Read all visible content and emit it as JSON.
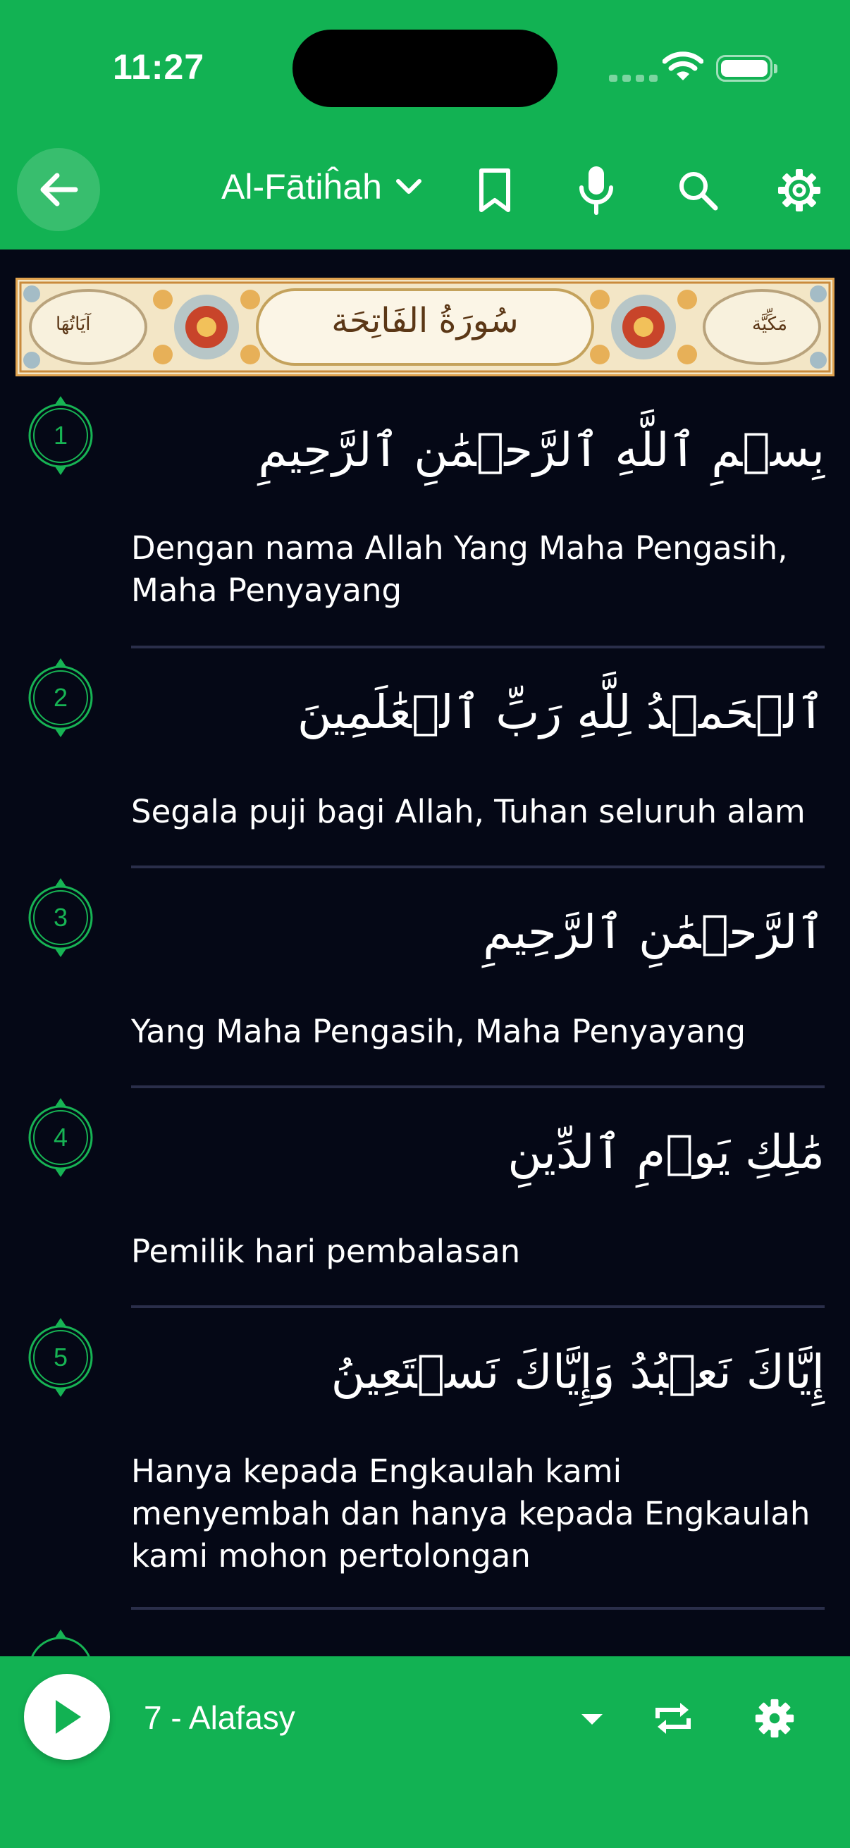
{
  "status_bar": {
    "time": "11:27"
  },
  "header": {
    "back_icon": "arrow-left-icon",
    "surah_title": "Al-Fātiĥah",
    "icons": [
      "bookmark-icon",
      "microphone-icon",
      "search-icon",
      "gear-icon"
    ]
  },
  "banner": {
    "surah_name_ar": "سُورَةُ الفَاتِحَة",
    "left_label": "آيَاتُهَا",
    "right_label": "مَكِّيَّة"
  },
  "verses": [
    {
      "number": "1",
      "arabic": "بِسۡمِ ٱللَّهِ ٱلرَّحۡمَٰنِ ٱلرَّحِيمِ",
      "translation": "Dengan nama Allah Yang Maha Pengasih, Maha Penyayang"
    },
    {
      "number": "2",
      "arabic": "ٱلۡحَمۡدُ لِلَّهِ رَبِّ ٱلۡعَٰلَمِينَ",
      "translation": "Segala puji bagi Allah, Tuhan seluruh alam"
    },
    {
      "number": "3",
      "arabic": "ٱلرَّحۡمَٰنِ ٱلرَّحِيمِ",
      "translation": "Yang Maha Pengasih, Maha Penyayang"
    },
    {
      "number": "4",
      "arabic": "مَٰلِكِ يَوۡمِ ٱلدِّينِ",
      "translation": "Pemilik hari pembalasan"
    },
    {
      "number": "5",
      "arabic": "إِيَّاكَ نَعۡبُدُ وَإِيَّاكَ نَسۡتَعِينُ",
      "translation": "Hanya kepada Engkaulah kami menyembah dan hanya kepada Engkaulah kami mohon pertolongan"
    }
  ],
  "player": {
    "reciter": "7 - Alafasy",
    "icons": [
      "play-icon",
      "dropdown-arrow-icon",
      "repeat-icon",
      "gear-icon"
    ]
  },
  "colors": {
    "accent_green": "#12b253",
    "background": "#050816",
    "divider": "#2a2e4a",
    "ayah_marker": "#17b454"
  }
}
